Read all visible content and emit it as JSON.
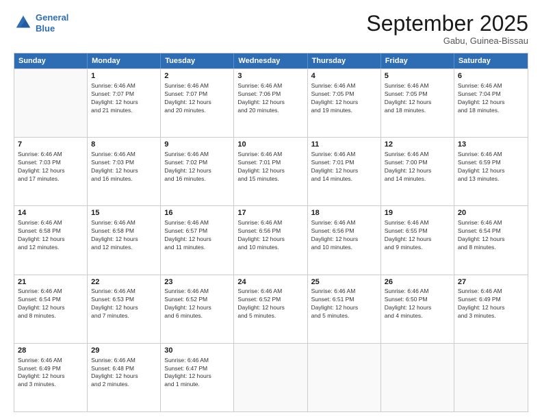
{
  "header": {
    "logo_line1": "General",
    "logo_line2": "Blue",
    "month": "September 2025",
    "location": "Gabu, Guinea-Bissau"
  },
  "weekdays": [
    "Sunday",
    "Monday",
    "Tuesday",
    "Wednesday",
    "Thursday",
    "Friday",
    "Saturday"
  ],
  "rows": [
    [
      {
        "day": "",
        "info": ""
      },
      {
        "day": "1",
        "info": "Sunrise: 6:46 AM\nSunset: 7:07 PM\nDaylight: 12 hours\nand 21 minutes."
      },
      {
        "day": "2",
        "info": "Sunrise: 6:46 AM\nSunset: 7:07 PM\nDaylight: 12 hours\nand 20 minutes."
      },
      {
        "day": "3",
        "info": "Sunrise: 6:46 AM\nSunset: 7:06 PM\nDaylight: 12 hours\nand 20 minutes."
      },
      {
        "day": "4",
        "info": "Sunrise: 6:46 AM\nSunset: 7:05 PM\nDaylight: 12 hours\nand 19 minutes."
      },
      {
        "day": "5",
        "info": "Sunrise: 6:46 AM\nSunset: 7:05 PM\nDaylight: 12 hours\nand 18 minutes."
      },
      {
        "day": "6",
        "info": "Sunrise: 6:46 AM\nSunset: 7:04 PM\nDaylight: 12 hours\nand 18 minutes."
      }
    ],
    [
      {
        "day": "7",
        "info": "Sunrise: 6:46 AM\nSunset: 7:03 PM\nDaylight: 12 hours\nand 17 minutes."
      },
      {
        "day": "8",
        "info": "Sunrise: 6:46 AM\nSunset: 7:03 PM\nDaylight: 12 hours\nand 16 minutes."
      },
      {
        "day": "9",
        "info": "Sunrise: 6:46 AM\nSunset: 7:02 PM\nDaylight: 12 hours\nand 16 minutes."
      },
      {
        "day": "10",
        "info": "Sunrise: 6:46 AM\nSunset: 7:01 PM\nDaylight: 12 hours\nand 15 minutes."
      },
      {
        "day": "11",
        "info": "Sunrise: 6:46 AM\nSunset: 7:01 PM\nDaylight: 12 hours\nand 14 minutes."
      },
      {
        "day": "12",
        "info": "Sunrise: 6:46 AM\nSunset: 7:00 PM\nDaylight: 12 hours\nand 14 minutes."
      },
      {
        "day": "13",
        "info": "Sunrise: 6:46 AM\nSunset: 6:59 PM\nDaylight: 12 hours\nand 13 minutes."
      }
    ],
    [
      {
        "day": "14",
        "info": "Sunrise: 6:46 AM\nSunset: 6:58 PM\nDaylight: 12 hours\nand 12 minutes."
      },
      {
        "day": "15",
        "info": "Sunrise: 6:46 AM\nSunset: 6:58 PM\nDaylight: 12 hours\nand 12 minutes."
      },
      {
        "day": "16",
        "info": "Sunrise: 6:46 AM\nSunset: 6:57 PM\nDaylight: 12 hours\nand 11 minutes."
      },
      {
        "day": "17",
        "info": "Sunrise: 6:46 AM\nSunset: 6:56 PM\nDaylight: 12 hours\nand 10 minutes."
      },
      {
        "day": "18",
        "info": "Sunrise: 6:46 AM\nSunset: 6:56 PM\nDaylight: 12 hours\nand 10 minutes."
      },
      {
        "day": "19",
        "info": "Sunrise: 6:46 AM\nSunset: 6:55 PM\nDaylight: 12 hours\nand 9 minutes."
      },
      {
        "day": "20",
        "info": "Sunrise: 6:46 AM\nSunset: 6:54 PM\nDaylight: 12 hours\nand 8 minutes."
      }
    ],
    [
      {
        "day": "21",
        "info": "Sunrise: 6:46 AM\nSunset: 6:54 PM\nDaylight: 12 hours\nand 8 minutes."
      },
      {
        "day": "22",
        "info": "Sunrise: 6:46 AM\nSunset: 6:53 PM\nDaylight: 12 hours\nand 7 minutes."
      },
      {
        "day": "23",
        "info": "Sunrise: 6:46 AM\nSunset: 6:52 PM\nDaylight: 12 hours\nand 6 minutes."
      },
      {
        "day": "24",
        "info": "Sunrise: 6:46 AM\nSunset: 6:52 PM\nDaylight: 12 hours\nand 5 minutes."
      },
      {
        "day": "25",
        "info": "Sunrise: 6:46 AM\nSunset: 6:51 PM\nDaylight: 12 hours\nand 5 minutes."
      },
      {
        "day": "26",
        "info": "Sunrise: 6:46 AM\nSunset: 6:50 PM\nDaylight: 12 hours\nand 4 minutes."
      },
      {
        "day": "27",
        "info": "Sunrise: 6:46 AM\nSunset: 6:49 PM\nDaylight: 12 hours\nand 3 minutes."
      }
    ],
    [
      {
        "day": "28",
        "info": "Sunrise: 6:46 AM\nSunset: 6:49 PM\nDaylight: 12 hours\nand 3 minutes."
      },
      {
        "day": "29",
        "info": "Sunrise: 6:46 AM\nSunset: 6:48 PM\nDaylight: 12 hours\nand 2 minutes."
      },
      {
        "day": "30",
        "info": "Sunrise: 6:46 AM\nSunset: 6:47 PM\nDaylight: 12 hours\nand 1 minute."
      },
      {
        "day": "",
        "info": ""
      },
      {
        "day": "",
        "info": ""
      },
      {
        "day": "",
        "info": ""
      },
      {
        "day": "",
        "info": ""
      }
    ]
  ]
}
